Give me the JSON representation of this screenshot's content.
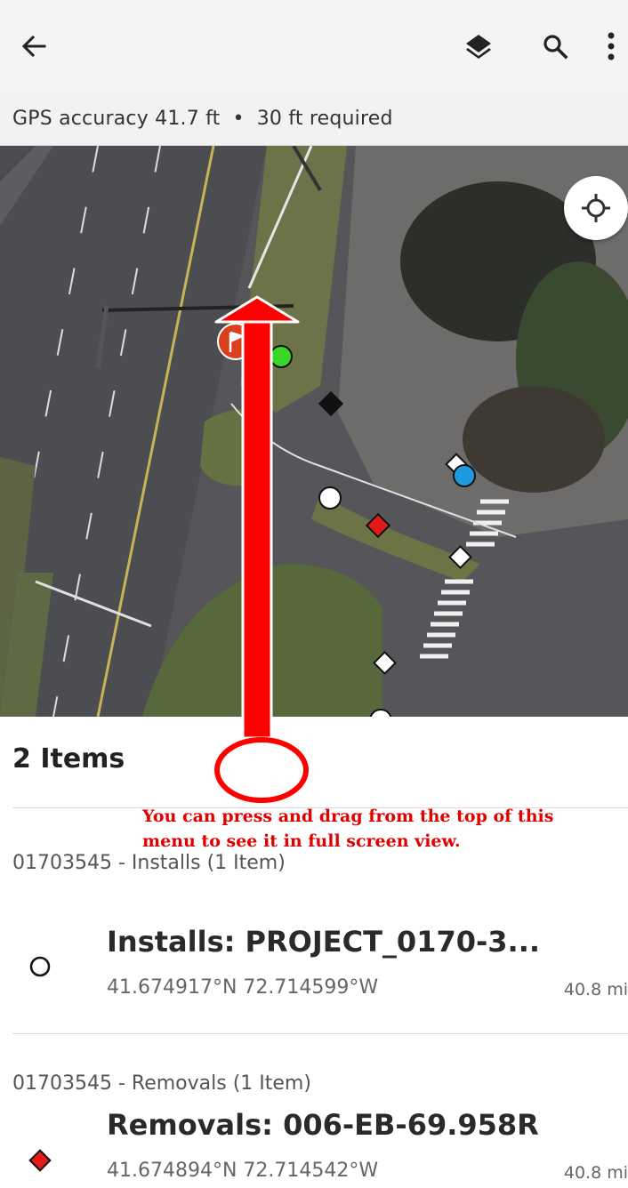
{
  "appbar": {
    "back_icon": "arrow-left-icon",
    "layers_icon": "layers-icon",
    "search_icon": "search-icon",
    "more_icon": "more-vertical-icon"
  },
  "gps": {
    "accuracy_text": "GPS accuracy 41.7 ft",
    "separator": "•",
    "required_text": "30 ft required"
  },
  "map": {
    "locate_icon": "crosshair-locate-icon",
    "marker_colors": {
      "flag": "#d9411e",
      "green": "#39d62a",
      "blue": "#1e9be0",
      "red_diamond": "#e21a1a",
      "black_diamond": "#111111",
      "white": "#ffffff"
    }
  },
  "annotation": {
    "arrow_color": "#ff0000",
    "text": "You can press and drag from the top of this menu to see it in full screen view."
  },
  "sheet": {
    "title": "2 Items",
    "groups": [
      {
        "label": "01703545 - Installs (1 Item)",
        "item": {
          "icon": "circle-outline-icon",
          "title": "Installs: PROJECT_0170-3...",
          "coords": "41.674917°N  72.714599°W",
          "distance": "40.8 mi"
        }
      },
      {
        "label": "01703545 - Removals (1 Item)",
        "item": {
          "icon": "red-diamond-icon",
          "title": "Removals: 006-EB-69.958R",
          "coords": "41.674894°N  72.714542°W",
          "distance": "40.8 mi"
        }
      }
    ]
  }
}
